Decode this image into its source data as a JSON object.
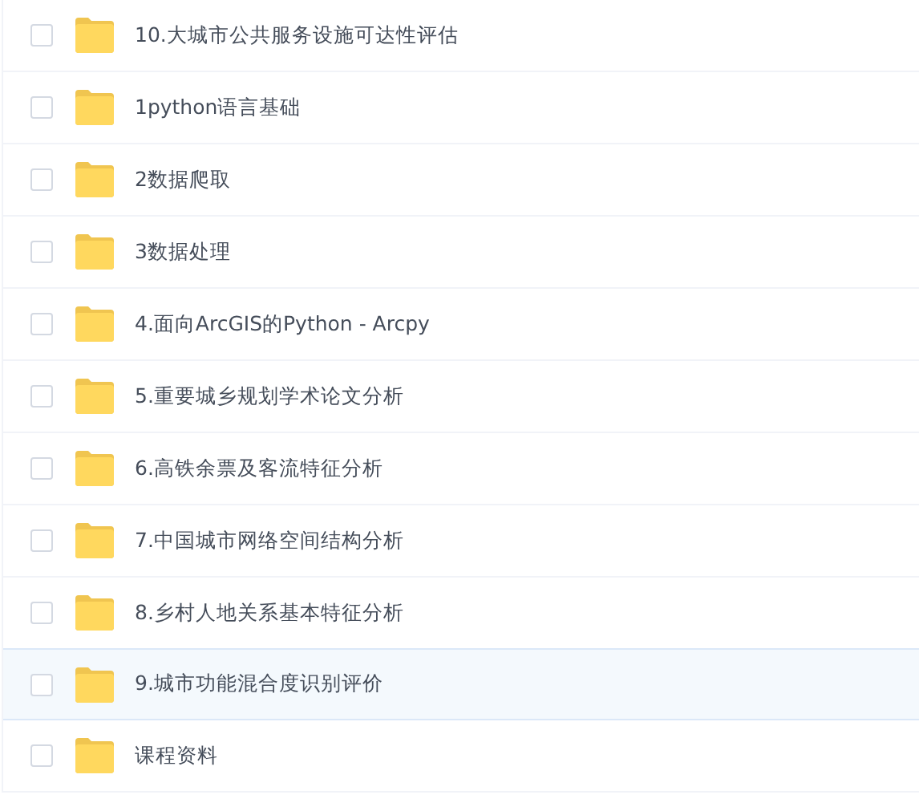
{
  "files": [
    {
      "name": "10.大城市公共服务设施可达性评估",
      "checked": false,
      "highlighted": false
    },
    {
      "name": "1python语言基础",
      "checked": false,
      "highlighted": false
    },
    {
      "name": "2数据爬取",
      "checked": false,
      "highlighted": false
    },
    {
      "name": "3数据处理",
      "checked": false,
      "highlighted": false
    },
    {
      "name": "4.面向ArcGIS的Python - Arcpy",
      "checked": false,
      "highlighted": false
    },
    {
      "name": "5.重要城乡规划学术论文分析",
      "checked": false,
      "highlighted": false
    },
    {
      "name": "6.高铁余票及客流特征分析",
      "checked": false,
      "highlighted": false
    },
    {
      "name": "7.中国城市网络空间结构分析",
      "checked": false,
      "highlighted": false
    },
    {
      "name": "8.乡村人地关系基本特征分析",
      "checked": false,
      "highlighted": false
    },
    {
      "name": "9.城市功能混合度识别评价",
      "checked": false,
      "highlighted": true
    },
    {
      "name": "课程资料",
      "checked": false,
      "highlighted": false
    }
  ]
}
